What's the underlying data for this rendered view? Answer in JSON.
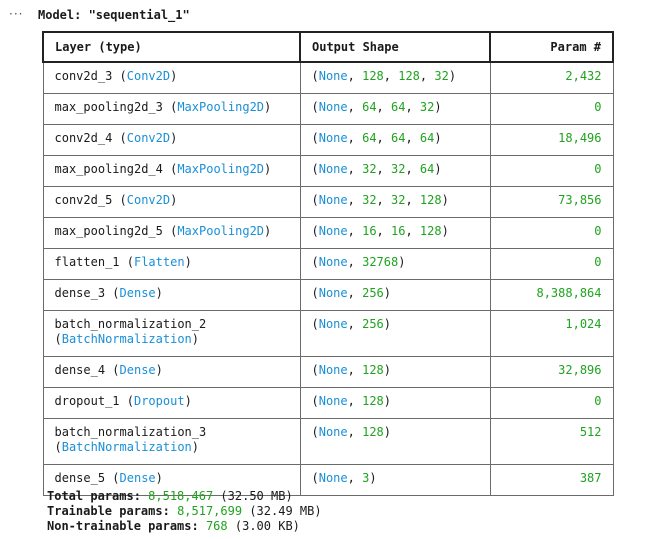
{
  "output_menu": "···",
  "model": {
    "title": "Model: \"sequential_1\""
  },
  "table": {
    "headers": {
      "layer": "Layer (type)",
      "output": "Output Shape",
      "params": "Param #"
    },
    "rows": [
      {
        "name": "conv2d_3",
        "type": "Conv2D",
        "dims": [
          "128",
          "128",
          "32"
        ],
        "params": "2,432"
      },
      {
        "name": "max_pooling2d_3",
        "type": "MaxPooling2D",
        "dims": [
          "64",
          "64",
          "32"
        ],
        "params": "0"
      },
      {
        "name": "conv2d_4",
        "type": "Conv2D",
        "dims": [
          "64",
          "64",
          "64"
        ],
        "params": "18,496"
      },
      {
        "name": "max_pooling2d_4",
        "type": "MaxPooling2D",
        "dims": [
          "32",
          "32",
          "64"
        ],
        "params": "0"
      },
      {
        "name": "conv2d_5",
        "type": "Conv2D",
        "dims": [
          "32",
          "32",
          "128"
        ],
        "params": "73,856"
      },
      {
        "name": "max_pooling2d_5",
        "type": "MaxPooling2D",
        "dims": [
          "16",
          "16",
          "128"
        ],
        "params": "0"
      },
      {
        "name": "flatten_1",
        "type": "Flatten",
        "dims": [
          "32768"
        ],
        "params": "0"
      },
      {
        "name": "dense_3",
        "type": "Dense",
        "dims": [
          "256"
        ],
        "params": "8,388,864"
      },
      {
        "name": "batch_normalization_2",
        "type": "BatchNormalization",
        "dims": [
          "256"
        ],
        "params": "1,024",
        "wrap_type": true
      },
      {
        "name": "dense_4",
        "type": "Dense",
        "dims": [
          "128"
        ],
        "params": "32,896"
      },
      {
        "name": "dropout_1",
        "type": "Dropout",
        "dims": [
          "128"
        ],
        "params": "0"
      },
      {
        "name": "batch_normalization_3",
        "type": "BatchNormalization",
        "dims": [
          "128"
        ],
        "params": "512",
        "wrap_type": true
      },
      {
        "name": "dense_5",
        "type": "Dense",
        "dims": [
          "3"
        ],
        "params": "387"
      }
    ],
    "none_label": "None"
  },
  "totals": {
    "total": {
      "label": "Total params:",
      "count": "8,518,467",
      "size": "(32.50 MB)"
    },
    "trainable": {
      "label": "Trainable params:",
      "count": "8,517,699",
      "size": "(32.49 MB)"
    },
    "non_trainable": {
      "label": "Non-trainable params:",
      "count": "768",
      "size": "(3.00 KB)"
    }
  },
  "colors": {
    "type": "#1a8fd6",
    "number": "#1fa31f"
  }
}
